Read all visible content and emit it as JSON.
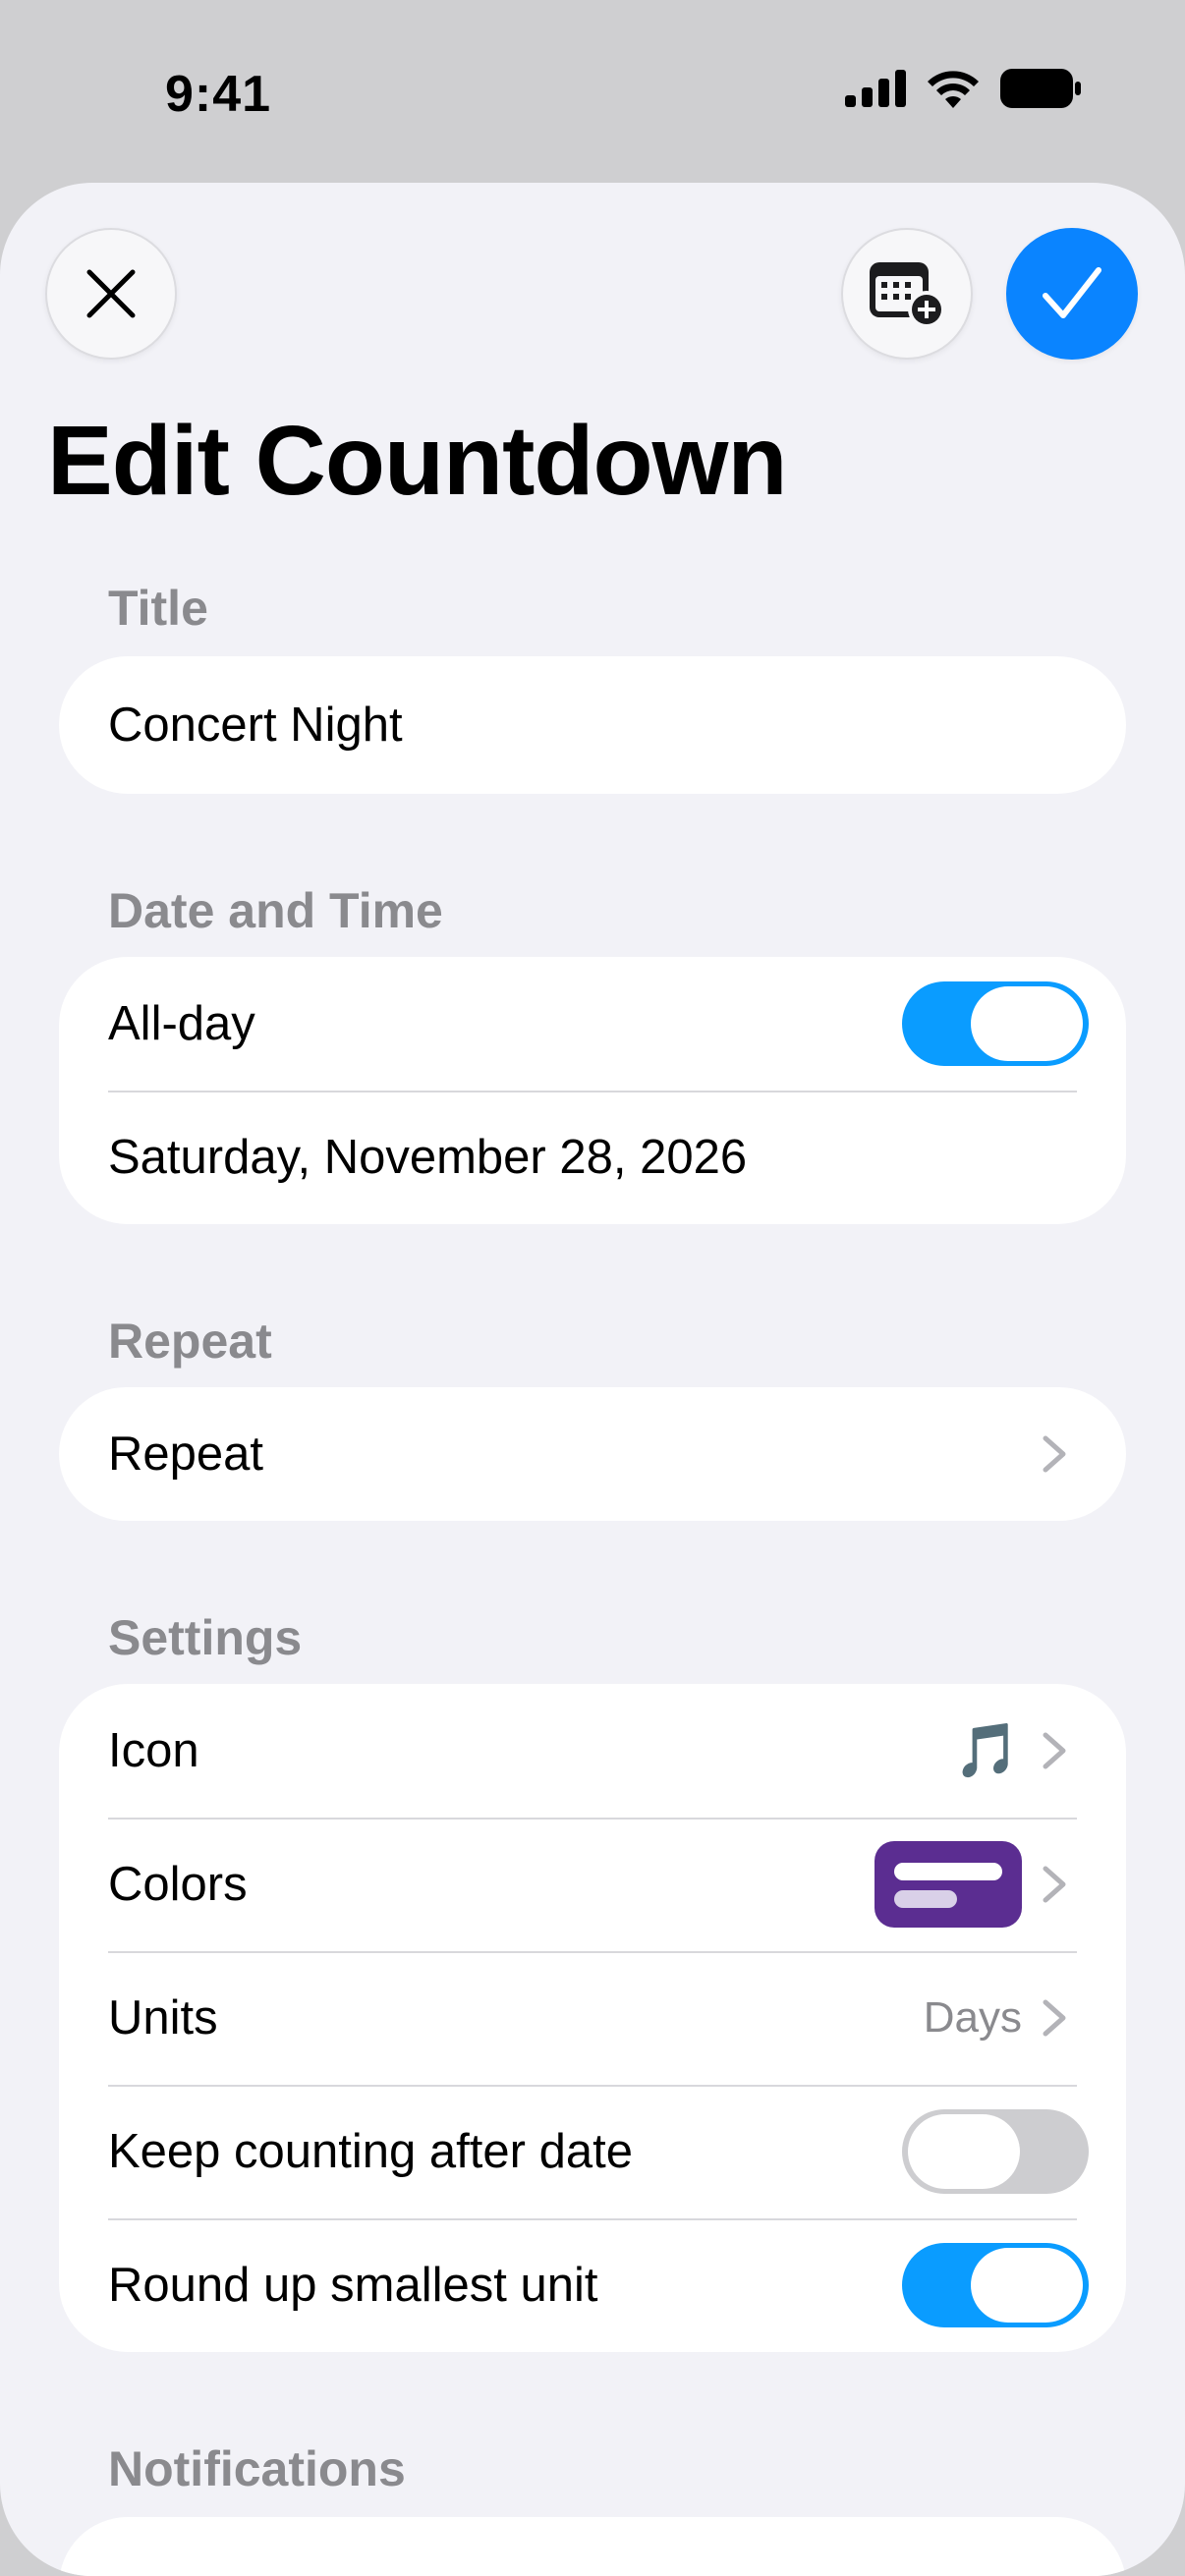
{
  "status_bar": {
    "time": "9:41"
  },
  "header": {
    "title": "Edit Countdown",
    "close_icon": "close-icon",
    "calendar_icon": "calendar-add-icon",
    "confirm_icon": "checkmark-icon"
  },
  "sections": {
    "title": {
      "label": "Title",
      "value": "Concert Night"
    },
    "date_time": {
      "label": "Date and Time",
      "all_day_label": "All-day",
      "all_day_on": true,
      "date_value": "Saturday, November 28, 2026"
    },
    "repeat": {
      "label": "Repeat",
      "row_label": "Repeat"
    },
    "settings": {
      "label": "Settings",
      "icon_label": "Icon",
      "icon_value": "🎵",
      "colors_label": "Colors",
      "colors_value": "#5b2d91",
      "units_label": "Units",
      "units_value": "Days",
      "keep_counting_label": "Keep counting after date",
      "keep_counting_on": false,
      "round_up_label": "Round up smallest unit",
      "round_up_on": true
    },
    "notifications": {
      "label": "Notifications"
    }
  },
  "colors": {
    "accent": "#0a84ff",
    "toggle_on": "#0a9cff",
    "background": "#f2f2f7"
  }
}
